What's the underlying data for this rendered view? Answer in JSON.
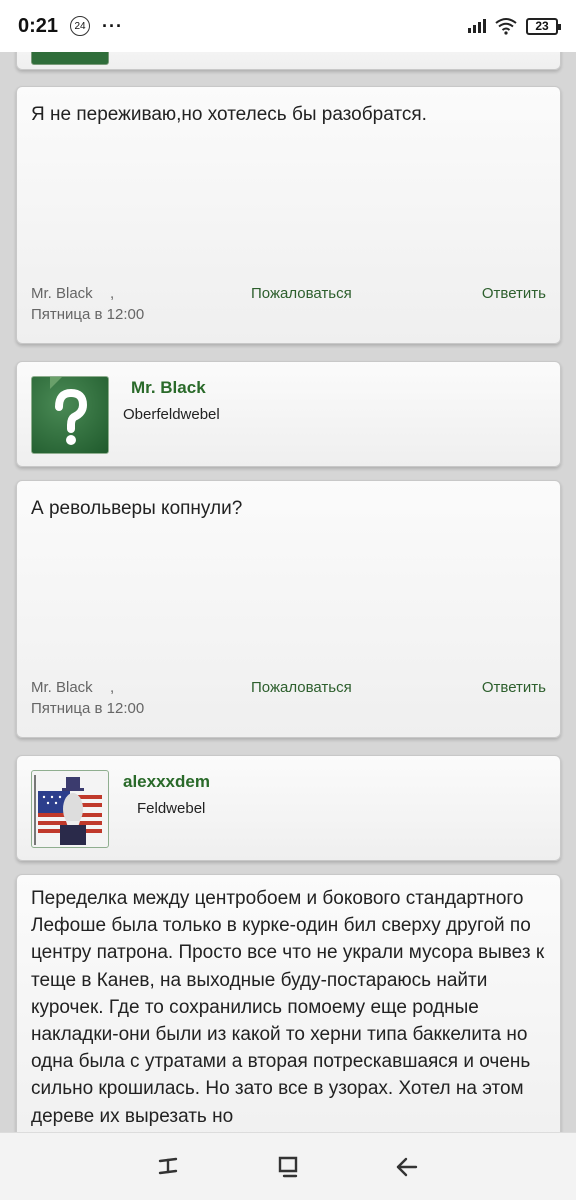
{
  "status_bar": {
    "time": "0:21",
    "notification_count": "24",
    "more": "···",
    "battery": "23"
  },
  "posts": [
    {
      "text": "Я не переживаю,но хотелесь бы разобратся.",
      "author": "Mr. Black",
      "comma": ",",
      "date": "Пятница в 12:00",
      "report_label": "Пожаловаться",
      "reply_label": "Ответить"
    },
    {
      "text": "А револьверы копнули?",
      "author": "Mr. Black",
      "comma": ",",
      "date": "Пятница в 12:00",
      "report_label": "Пожаловаться",
      "reply_label": "Ответить"
    },
    {
      "text": "Переделка между центробоем и бокового стандартного Лефоше была только в курке-один бил сверху другой по центру патрона. Просто все что не украли мусора вывез к теще в Канев, на выходные буду-постараюсь найти курочек. Где то сохранились помоему еще родные накладки-они были из какой то херни типа баккелита но одна была с утратами а вторая потрескавшаяся и очень сильно крошилась. Но зато все в узорах. Хотел на этом дереве их вырезать но"
    }
  ],
  "users": [
    {
      "name": "Mr. Black",
      "rank": "Oberfeldwebel",
      "avatar_icon": "question-mark-icon"
    },
    {
      "name": "alexxxdem",
      "rank": "Feldwebel",
      "avatar_icon": "uncle-sam-flag-avatar"
    }
  ],
  "colors": {
    "accent_green": "#2d5f2d",
    "background": "#d6d6d6"
  }
}
